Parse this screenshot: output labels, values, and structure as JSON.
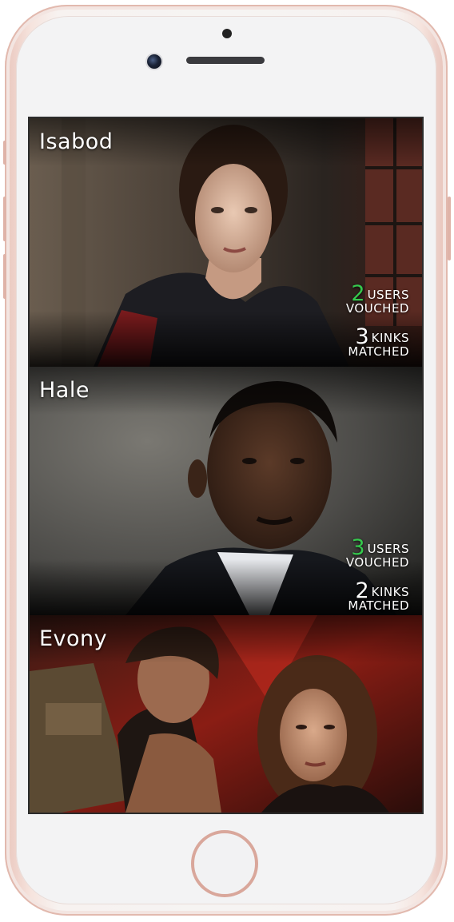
{
  "accent_colors": {
    "vouched_number": "#35c94d",
    "kinks_number": "#ffffff"
  },
  "cards": [
    {
      "name": "Isabod",
      "users_vouched": {
        "number": "2",
        "word": "USERS",
        "label": "VOUCHED"
      },
      "kinks_matched": {
        "number": "3",
        "word": "KINKS",
        "label": "MATCHED"
      }
    },
    {
      "name": "Hale",
      "users_vouched": {
        "number": "3",
        "word": "USERS",
        "label": "VOUCHED"
      },
      "kinks_matched": {
        "number": "2",
        "word": "KINKS",
        "label": "MATCHED"
      }
    },
    {
      "name": "Evony"
    }
  ]
}
